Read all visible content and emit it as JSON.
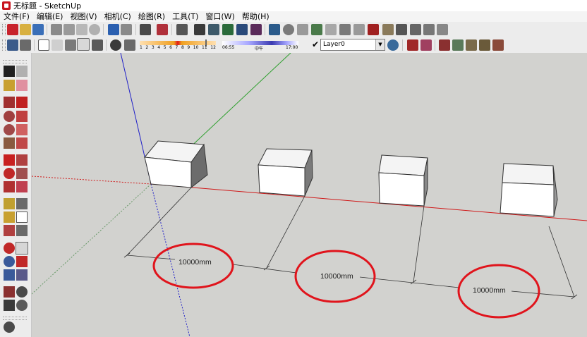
{
  "window": {
    "title": "无标题 - SketchUp"
  },
  "menus": [
    "文件(F)",
    "编辑(E)",
    "视图(V)",
    "相机(C)",
    "绘图(R)",
    "工具(T)",
    "窗口(W)",
    "帮助(H)"
  ],
  "shadow": {
    "month_ticks": [
      "1",
      "2",
      "3",
      "4",
      "5",
      "6",
      "7",
      "8",
      "9",
      "10",
      "11",
      "12"
    ]
  },
  "time": {
    "start": "06:55",
    "mid": "中午",
    "end": "17:00"
  },
  "layer": {
    "current": "Layer0"
  },
  "dimensions": [
    {
      "label": "10000mm"
    },
    {
      "label": "10000mm"
    },
    {
      "label": "10000mm"
    }
  ],
  "colors": {
    "x_axis": "#d01818",
    "y_axis": "#2fa02f",
    "z_axis": "#2020c8",
    "highlight_circle": "#e0141c",
    "sky_ground": "#d2d2cf"
  }
}
